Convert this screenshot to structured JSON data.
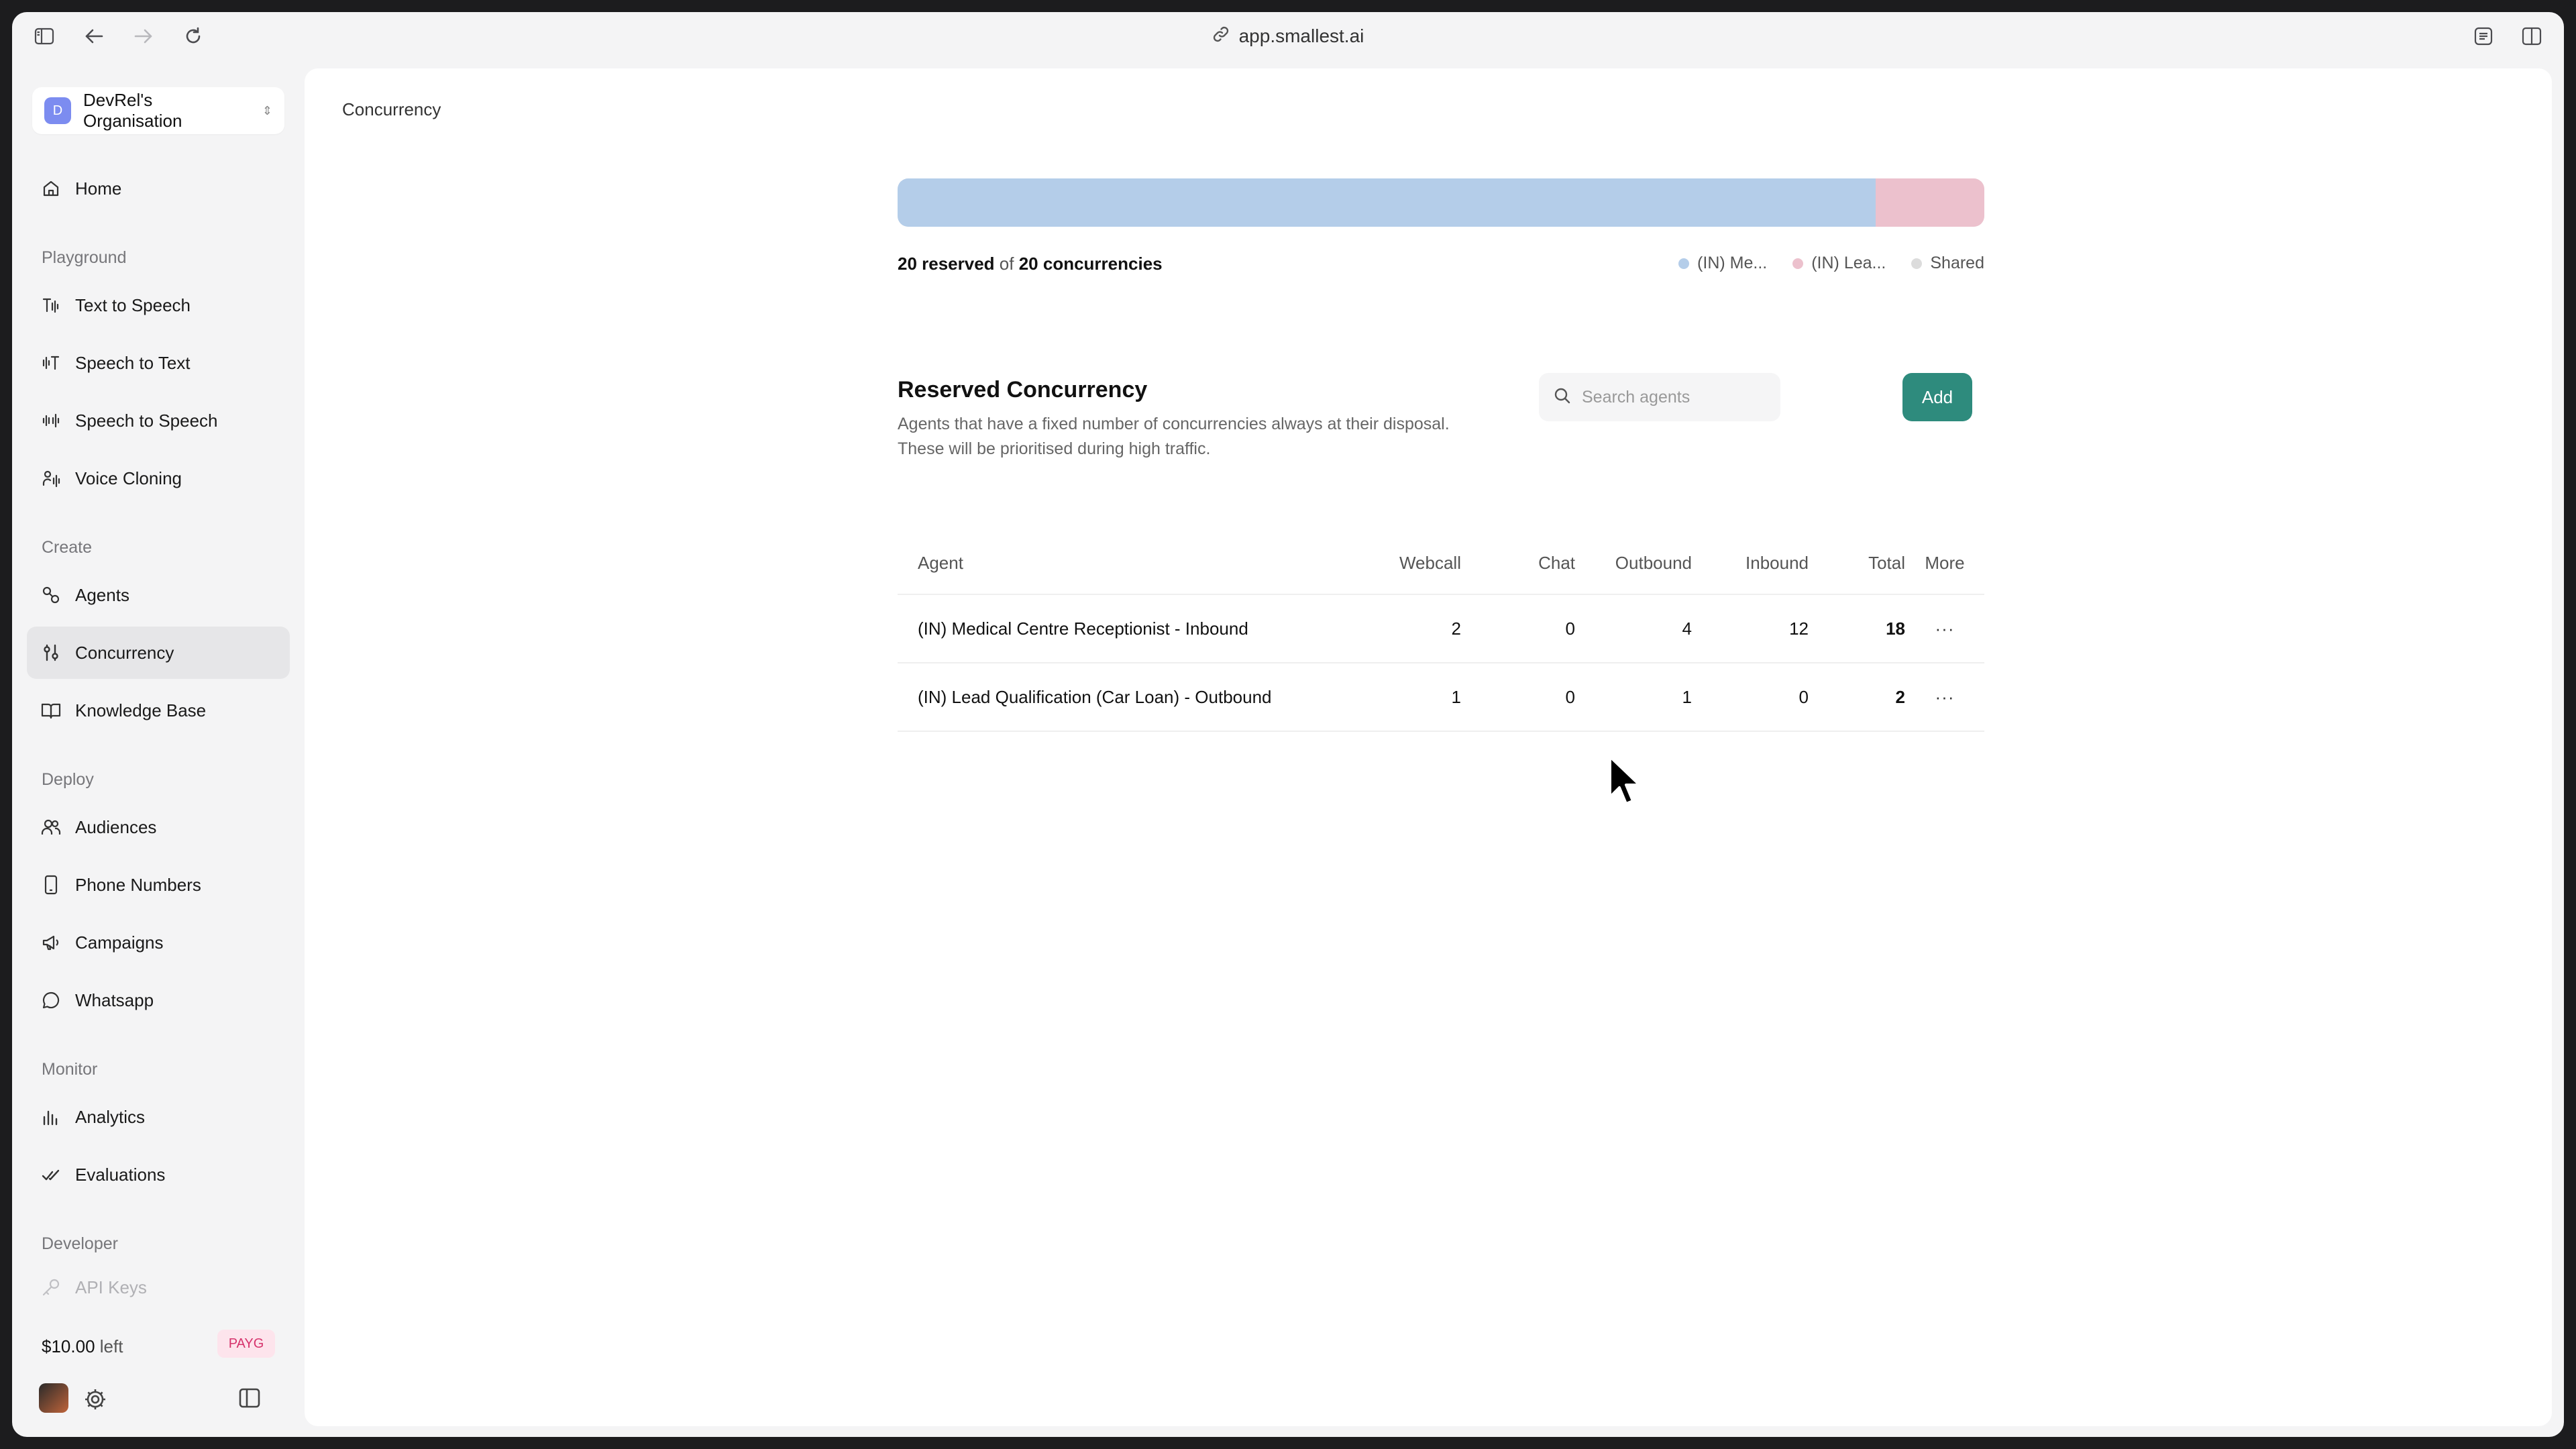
{
  "browser": {
    "url": "app.smallest.ai"
  },
  "sidebar": {
    "org": {
      "initial": "D",
      "name": "DevRel's Organisation"
    },
    "home": "Home",
    "sections": {
      "playground": "Playground",
      "create": "Create",
      "deploy": "Deploy",
      "monitor": "Monitor",
      "developer": "Developer"
    },
    "items": {
      "tts": "Text to Speech",
      "stt": "Speech to Text",
      "sts": "Speech to Speech",
      "cloning": "Voice Cloning",
      "agents": "Agents",
      "concurrency": "Concurrency",
      "kb": "Knowledge Base",
      "audiences": "Audiences",
      "phone": "Phone Numbers",
      "campaigns": "Campaigns",
      "whatsapp": "Whatsapp",
      "analytics": "Analytics",
      "evaluations": "Evaluations",
      "apikeys": "API Keys"
    },
    "credits": {
      "amount": "$10.00",
      "suffix": "left",
      "plan": "PAYG"
    }
  },
  "main": {
    "breadcrumb": "Concurrency",
    "usage": {
      "reserved": "20 reserved",
      "of": "of",
      "total": "20 concurrencies",
      "segments": [
        {
          "name": "(IN) Me...",
          "value": 18,
          "color": "#b4cde9"
        },
        {
          "name": "(IN) Lea...",
          "value": 2,
          "color": "#ecc1cd"
        },
        {
          "name": "Shared",
          "value": 0,
          "color": "#dcdcdc"
        }
      ]
    },
    "reserved": {
      "title": "Reserved Concurrency",
      "desc1": "Agents that have a fixed number of concurrencies always at their disposal.",
      "desc2": "These will be prioritised during high traffic.",
      "search_placeholder": "Search agents",
      "add": "Add"
    },
    "table": {
      "headers": {
        "agent": "Agent",
        "webcall": "Webcall",
        "chat": "Chat",
        "outbound": "Outbound",
        "inbound": "Inbound",
        "total": "Total",
        "more": "More"
      },
      "rows": [
        {
          "agent": "(IN) Medical Centre Receptionist - Inbound",
          "webcall": "2",
          "chat": "0",
          "outbound": "4",
          "inbound": "12",
          "total": "18",
          "more": "···"
        },
        {
          "agent": "(IN) Lead Qualification (Car Loan) - Outbound",
          "webcall": "1",
          "chat": "0",
          "outbound": "1",
          "inbound": "0",
          "total": "2",
          "more": "···"
        }
      ]
    }
  }
}
